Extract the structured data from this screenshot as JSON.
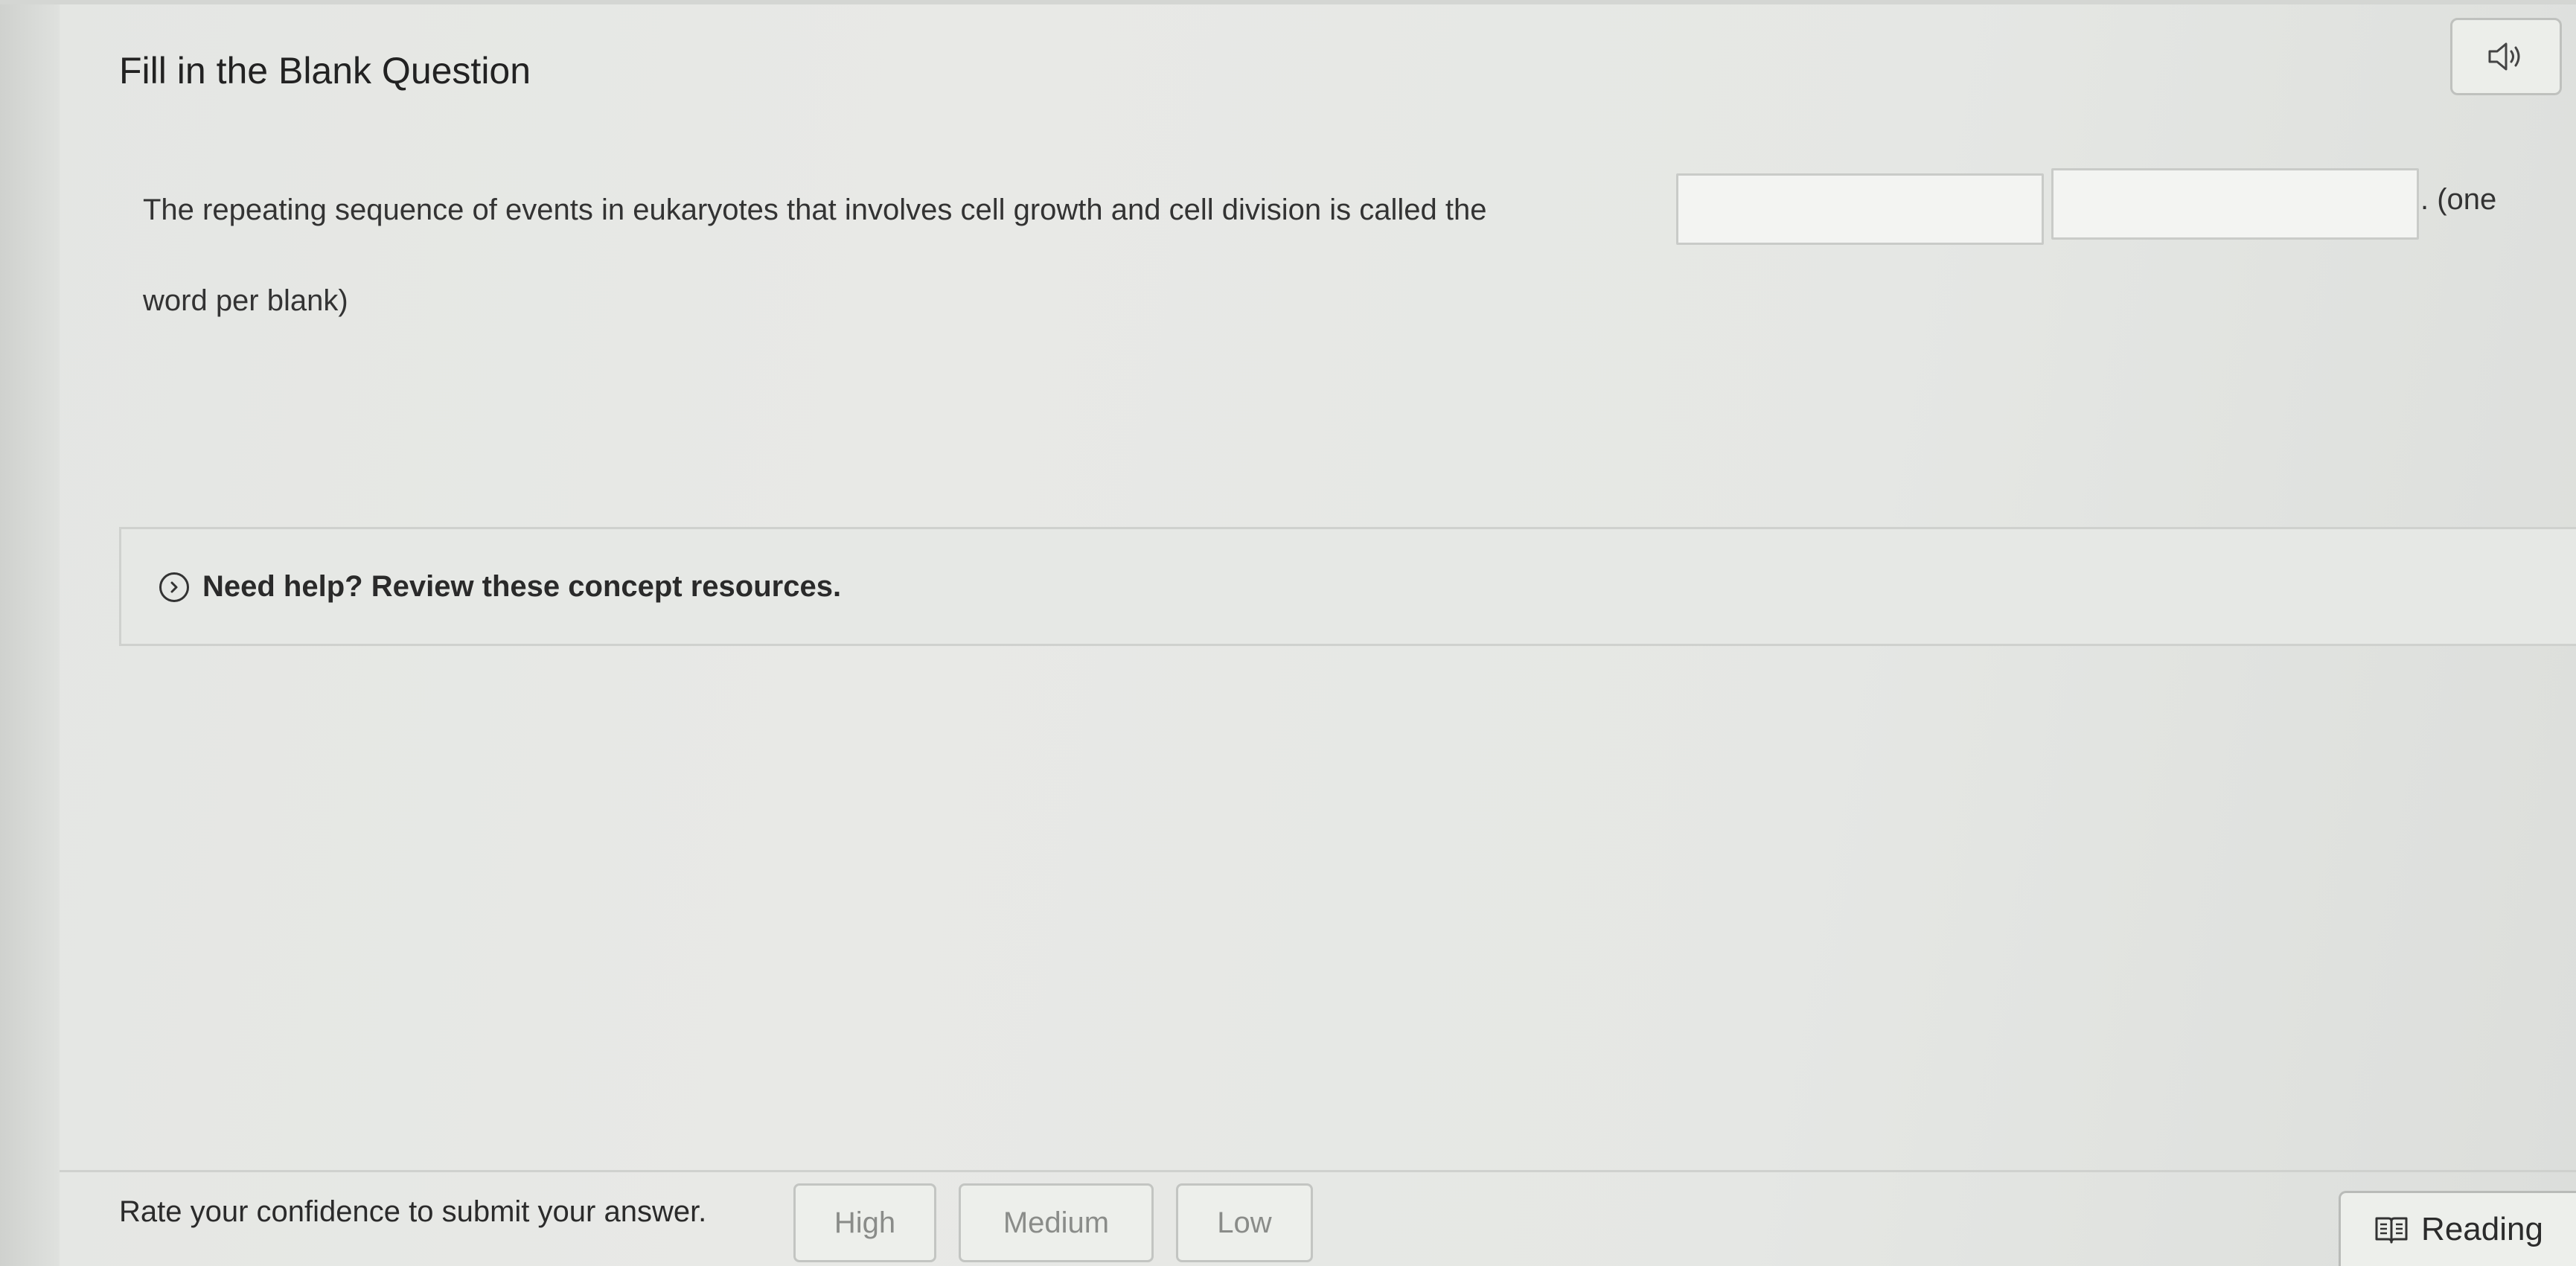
{
  "header": {
    "title": "Fill in the Blank Question",
    "audio_icon": "speaker-icon"
  },
  "question": {
    "text_before": "The repeating sequence of events in eukaryotes that involves cell growth and cell division is called the",
    "blanks": [
      {
        "value": "",
        "placeholder": ""
      },
      {
        "value": "",
        "placeholder": ""
      }
    ],
    "text_after": ". (one",
    "text_after_cont": "word per blank)"
  },
  "help": {
    "label": "Need help? Review these concept resources.",
    "icon": "chevron-circle-icon"
  },
  "footer": {
    "prompt": "Rate your confidence to submit your answer.",
    "confidence_options": [
      "High",
      "Medium",
      "Low"
    ],
    "reading_label": "Reading",
    "reading_icon": "book-icon"
  }
}
